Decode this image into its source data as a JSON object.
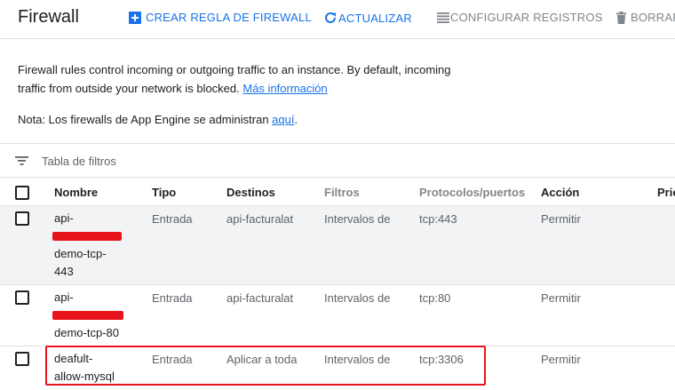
{
  "header": {
    "title": "Firewall",
    "create_label": "CREAR REGLA DE FIREWALL",
    "refresh_label": "ACTUALIZAR",
    "config_label": "CONFIGURAR REGISTROS",
    "delete_label": "BORRAR"
  },
  "info": {
    "text": "Firewall rules control incoming or outgoing traffic to an instance. By default, incoming traffic from outside your network is blocked.",
    "more_link": "Más información",
    "note_prefix": "Nota: Los firewalls de App Engine se administran",
    "note_link": "aquí",
    "note_suffix": "."
  },
  "filter": {
    "placeholder": "Tabla de filtros"
  },
  "table": {
    "headers": {
      "name": "Nombre",
      "type": "Tipo",
      "targets": "Destinos",
      "filters": "Filtros",
      "protocols": "Protocolos/puertos",
      "action": "Acción",
      "priority": "Prio"
    },
    "rows": [
      {
        "name_1": "api-",
        "name_2": "demo-tcp-",
        "name_3": "443",
        "type": "Entrada",
        "targets": "api-facturalat",
        "filters": "Intervalos de",
        "protocols": "tcp:443",
        "action": "Permitir"
      },
      {
        "name_1": "api-",
        "name_2": "demo-tcp-80",
        "type": "Entrada",
        "targets": "api-facturalat",
        "filters": "Intervalos de",
        "protocols": "tcp:80",
        "action": "Permitir"
      },
      {
        "name_1": "deafult-",
        "name_2": "allow-mysql",
        "type": "Entrada",
        "targets": "Aplicar a toda",
        "filters": "Intervalos de",
        "protocols": "tcp:3306",
        "action": "Permitir"
      }
    ]
  },
  "colors": {
    "accent": "#1a73e8",
    "highlight": "#e8141b",
    "row_shade": "#f1f3f4"
  }
}
